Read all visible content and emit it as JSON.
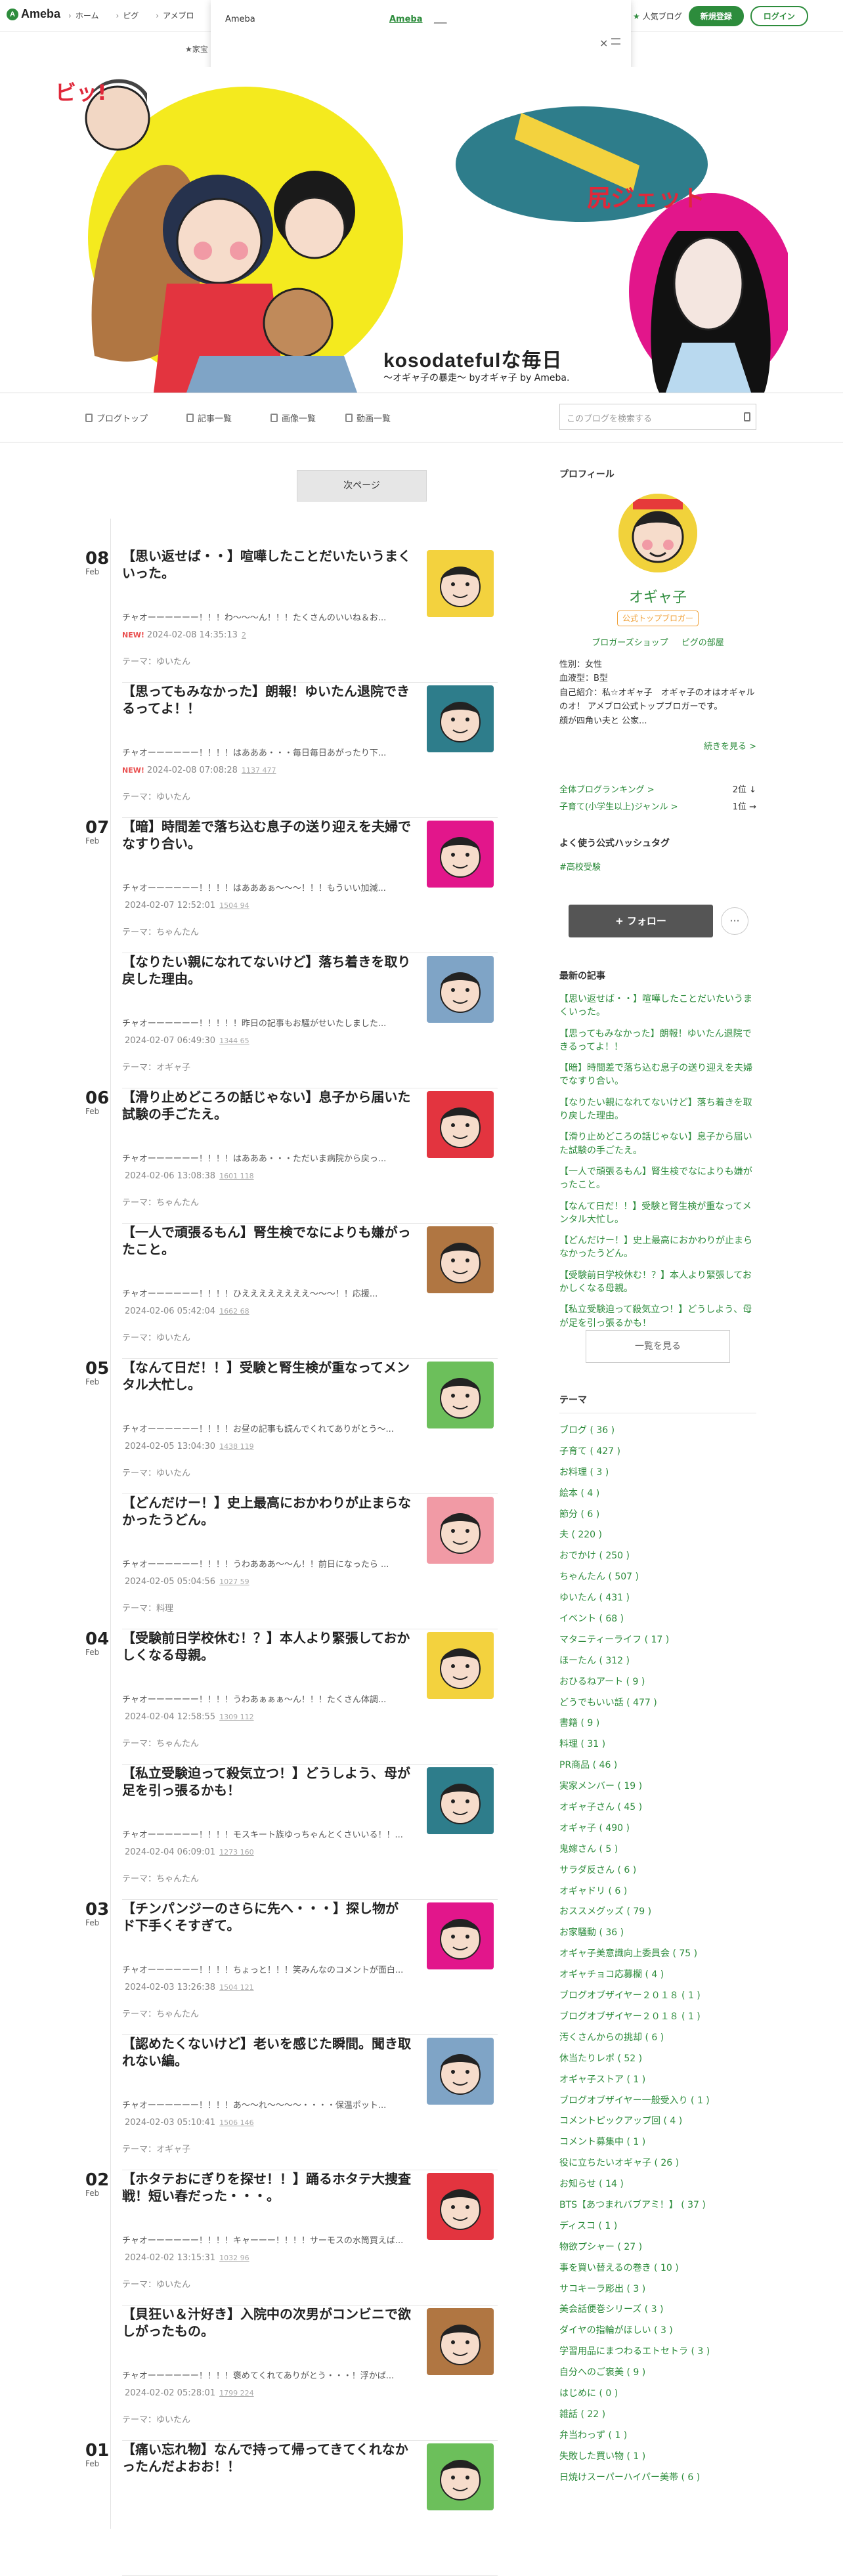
{
  "topbar": {
    "logo": "Ameba",
    "nav": [
      "ホーム",
      "ピグ",
      "アメブロ"
    ],
    "sub_link": "★家宝",
    "popular": "人気ブログ",
    "register": "新規登録",
    "login": "ログイン"
  },
  "popup": {
    "label": "Ameba",
    "link_active": "Ameba",
    "link_other": "___",
    "close": "×"
  },
  "hero": {
    "title": "kosodatefulな毎日",
    "subtitle": "〜オギャ子の暴走〜 byオギャ子 by Ameba.",
    "bubble1": "ビッ!",
    "bubble2": "尻ジェット"
  },
  "blognav": {
    "items": [
      "ブログトップ",
      "記事一覧",
      "画像一覧",
      "動画一覧"
    ],
    "search_placeholder": "このブログを検索する"
  },
  "next_page": "次ページ",
  "dates": [
    {
      "day": "08",
      "month": "Feb"
    },
    {
      "day": "07",
      "month": "Feb"
    },
    {
      "day": "06",
      "month": "Feb"
    },
    {
      "day": "05",
      "month": "Feb"
    },
    {
      "day": "04",
      "month": "Feb"
    },
    {
      "day": "03",
      "month": "Feb"
    },
    {
      "day": "02",
      "month": "Feb"
    },
    {
      "day": "01",
      "month": "Feb"
    }
  ],
  "posts": [
    {
      "title": "【思い返せば・・】喧嘩したことだいたいうまくいった。",
      "excerpt": "チャオーーーーーー！！！わ〜〜〜ん！！！たくさんのいいね＆お...",
      "new": "NEW!",
      "date": "2024-02-08 14:35:13",
      "counts": "2  ",
      "theme": "テーマ：ゆいたん"
    },
    {
      "title": "【思ってもみなかった】朗報！ゆいたん退院できるってよ！！",
      "excerpt": "チャオーーーーーー！！！！はあああ・・・毎日毎日あがったり下...",
      "new": "NEW!",
      "date": "2024-02-08 07:08:28",
      "counts": "1137  477",
      "theme": "テーマ：ゆいたん"
    },
    {
      "title": "【暗】時間差で落ち込む息子の送り迎えを夫婦でなすり合い。",
      "excerpt": "チャオーーーーーー！！！！はあああぁ〜〜〜！！！もういい加減...",
      "new": "",
      "date": "2024-02-07 12:52:01",
      "counts": "1504  94",
      "theme": "テーマ：ちゃんたん"
    },
    {
      "title": "【なりたい親になれてないけど】落ち着きを取り戻した理由。",
      "excerpt": "チャオーーーーーー！！！！！昨日の記事もお騒がせいたしました...",
      "new": "",
      "date": "2024-02-07 06:49:30",
      "counts": "1344  65",
      "theme": "テーマ：オギャ子"
    },
    {
      "title": "【滑り止めどころの話じゃない】息子から届いた試験の手ごたえ。",
      "excerpt": "チャオーーーーーー！！！！はあああ・・・ただいま病院から戻っ...",
      "new": "",
      "date": "2024-02-06 13:08:38",
      "counts": "1601  118",
      "theme": "テーマ：ちゃんたん"
    },
    {
      "title": "【一人で頑張るもん】腎生検でなによりも嫌がったこと。",
      "excerpt": "チャオーーーーーー！！！！ひええええええええ〜〜〜！！応援...",
      "new": "",
      "date": "2024-02-06 05:42:04",
      "counts": "1662  68",
      "theme": "テーマ：ゆいたん"
    },
    {
      "title": "【なんて日だ！！】受験と腎生検が重なってメンタル大忙し。",
      "excerpt": "チャオーーーーーー！！！！お昼の記事も読んでくれてありがとう〜...",
      "new": "",
      "date": "2024-02-05 13:04:30",
      "counts": "1438  119",
      "theme": "テーマ：ゆいたん"
    },
    {
      "title": "【どんだけー！】史上最高におかわりが止まらなかったうどん。",
      "excerpt": "チャオーーーーーー！！！！うわあああ〜〜ん！！前日になったら ...",
      "new": "",
      "date": "2024-02-05 05:04:56",
      "counts": "1027  59",
      "theme": "テーマ：料理"
    },
    {
      "title": "【受験前日学校休む！？】本人より緊張しておかしくなる母親。",
      "excerpt": "チャオーーーーーー！！！！うわあぁぁぁ〜ん！！！たくさん体調...",
      "new": "",
      "date": "2024-02-04 12:58:55",
      "counts": "1309  112",
      "theme": "テーマ：ちゃんたん"
    },
    {
      "title": "【私立受験迫って殺気立つ！】どうしよう、母が足を引っ張るかも！",
      "excerpt": "チャオーーーーーー！！！！モスキート族ゆっちゃんとくさいいる！！...",
      "new": "",
      "date": "2024-02-04 06:09:01",
      "counts": "1273  160",
      "theme": "テーマ：ちゃんたん"
    },
    {
      "title": "【チンパンジーのさらに先へ・・・】探し物がド下手くそすぎて。",
      "excerpt": "チャオーーーーーー！！！！ちょっと！！！笑みんなのコメントが面白...",
      "new": "",
      "date": "2024-02-03 13:26:38",
      "counts": "1504  121",
      "theme": "テーマ：ちゃんたん"
    },
    {
      "title": "【認めたくないけど】老いを感じた瞬間。聞き取れない編。",
      "excerpt": "チャオーーーーーー！！！！あ〜〜れ〜〜〜〜・・・・保温ポット...",
      "new": "",
      "date": "2024-02-03 05:10:41",
      "counts": "1506  146",
      "theme": "テーマ：オギャ子"
    },
    {
      "title": "【ホタテおにぎりを探せ！！】踊るホタテ大捜査戦！短い春だった・・・。",
      "excerpt": "チャオーーーーーー！！！！キャーーー！！！！サーモスの水筒買えば...",
      "new": "",
      "date": "2024-02-02 13:15:31",
      "counts": "1032  96",
      "theme": "テーマ：ゆいたん"
    },
    {
      "title": "【貝狂い＆汁好き】入院中の次男がコンビニで欲しがったもの。",
      "excerpt": "チャオーーーーーー！！！！褒めてくれてありがとう・・・！浮かば...",
      "new": "",
      "date": "2024-02-02 05:28:01",
      "counts": "1799  224",
      "theme": "テーマ：ゆいたん"
    },
    {
      "title": "【痛い忘れ物】なんで持って帰ってきてくれなかったんだよおお！！",
      "excerpt": "",
      "new": "",
      "date": "",
      "counts": "",
      "theme": ""
    }
  ],
  "profile": {
    "heading": "プロフィール",
    "name": "オギャ子",
    "badge": "公式トップブロガー",
    "link1": "ブロガーズショップ",
    "link2": "ピグの部屋",
    "info1": "性別：女性",
    "info2": "血液型：B型",
    "info3": "自己紹介：私☆オギャ子　オギャ子のオはオギャルのオ！ アメブロ公式トップブロガーです。",
    "info4": "顔が四角い夫と 公家...",
    "more": "続きを見る >",
    "rank1_label": "全体ブログランキング >",
    "rank1_val": "2位 ↓",
    "rank2_label": "子育て(小学生以上)ジャンル >",
    "rank2_val": "1位 →",
    "hash_heading": "よく使う公式ハッシュタグ",
    "hashtag": "#高校受験",
    "follow": "+ フォロー",
    "dots": "···"
  },
  "latest": {
    "heading": "最新の記事",
    "items": [
      "【思い返せば・・】喧嘩したことだいたいうまくいった。",
      "【思ってもみなかった】朗報！ゆいたん退院できるってよ！！",
      "【暗】時間差で落ち込む息子の送り迎えを夫婦でなすり合い。",
      "【なりたい親になれてないけど】落ち着きを取り戻した理由。",
      "【滑り止めどころの話じゃない】息子から届いた試験の手ごたえ。",
      "【一人で頑張るもん】腎生検でなによりも嫌がったこと。",
      "【なんて日だ！！】受験と腎生検が重なってメンタル大忙し。",
      "【どんだけー！】史上最高におかわりが止まらなかったうどん。",
      "【受験前日学校休む！？】本人より緊張しておかしくなる母親。",
      "【私立受験迫って殺気立つ！】どうしよう、母が足を引っ張るかも！"
    ],
    "list_button": "一覧を見る"
  },
  "themes": {
    "heading": "テーマ",
    "items": [
      "ブログ ( 36 )",
      "子育て ( 427 )",
      "お料理 ( 3 )",
      "絵本 ( 4 )",
      "節分 ( 6 )",
      "夫 ( 220 )",
      "おでかけ ( 250 )",
      "ちゃんたん ( 507 )",
      "ゆいたん ( 431 )",
      "イベント ( 68 )",
      "マタニティーライフ ( 17 )",
      "ほーたん ( 312 )",
      "おひるねアート ( 9 )",
      "どうでもいい話 ( 477 )",
      "書籍 ( 9 )",
      "料理 ( 31 )",
      "PR商品 ( 46 )",
      "実家メンバー ( 19 )",
      "オギャ子さん ( 45 )",
      "オギャ子 ( 490 )",
      "鬼嫁さん ( 5 )",
      "サラダ反さん ( 6 )",
      "オギャドリ ( 6 )",
      "おススメグッズ ( 79 )",
      "お家騒動 ( 36 )",
      "オギャ子美意識向上委員会 ( 75 )",
      "オギャチョコ応募欄 ( 4 )",
      "ブログオブザイヤー２０１８ ( 1 )",
      "ブログオブザイヤー２０１８ ( 1 )",
      "汚くさんからの挑却 ( 6 )",
      "休当たりレポ ( 52 )",
      "オギャ子ストア ( 1 )",
      "ブログオブザイヤー一般受入り ( 1 )",
      "コメントピックアップ回 ( 4 )",
      "コメント募集中 ( 1 )",
      "役に立ちたいオギャ子 ( 26 )",
      "お知らせ ( 14 )",
      "BTS【あつまれバブアミ！】 ( 37 )",
      "ディスコ ( 1 )",
      "物欲プシャー ( 27 )",
      "事を買い替えるの巻き ( 10 )",
      "サコキーラ彫出 ( 3 )",
      "美会話便巻シリーズ ( 3 )",
      "ダイヤの指輪がほしい ( 3 )",
      "学習用品にまつわるエトセトラ ( 3 )",
      "自分へのご褒美 ( 9 )",
      "はじめに ( 0 )",
      "雑話 ( 22 )",
      "弁当わっず ( 1 )",
      "失敗した買い物 ( 1 )",
      "日焼けスーパーハイパー美帯 ( 6 )"
    ]
  },
  "colors": {
    "accent": "#2d8c3c",
    "new": "#e94e4e",
    "badge": "#f0a23b"
  }
}
